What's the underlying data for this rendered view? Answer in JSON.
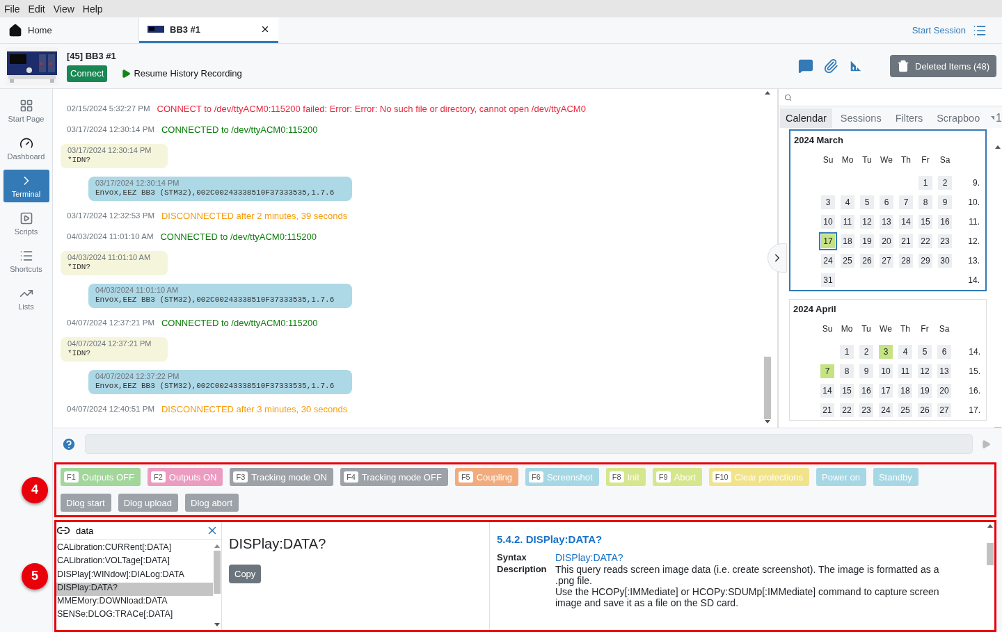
{
  "menu": [
    "File",
    "Edit",
    "View",
    "Help"
  ],
  "tabs": [
    {
      "label": "Home",
      "kind": "home",
      "selected": false,
      "closable": false
    },
    {
      "label": "BB3 #1",
      "kind": "instrument",
      "selected": true,
      "closable": true
    }
  ],
  "session_link": "Start Session",
  "instrument": {
    "title": "[45] BB3 #1",
    "connect": "Connect",
    "history": "Resume History Recording",
    "deleted": "Deleted Items (48)"
  },
  "sidebar": [
    {
      "label": "Start Page",
      "kind": "grid",
      "selected": false
    },
    {
      "label": "Dashboard",
      "kind": "gauge",
      "selected": false
    },
    {
      "label": "Terminal",
      "kind": "terminal",
      "selected": true
    },
    {
      "label": "Scripts",
      "kind": "scripts",
      "selected": false
    },
    {
      "label": "Shortcuts",
      "kind": "shortcuts",
      "selected": false
    },
    {
      "label": "Lists",
      "kind": "lists",
      "selected": false
    }
  ],
  "log": [
    {
      "kind": "error",
      "time": "02/15/2024 5:32:27 PM",
      "text": "CONNECT to /dev/ttyACM0:115200 failed: Error: Error: No such file or directory, cannot open /dev/ttyACM0"
    },
    {
      "kind": "connected",
      "time": "03/17/2024 12:30:14 PM",
      "text": "CONNECTED to /dev/ttyACM0:115200"
    },
    {
      "kind": "request",
      "time": "03/17/2024 12:30:14 PM",
      "text": "*IDN?"
    },
    {
      "kind": "response",
      "time": "03/17/2024 12:30:14 PM",
      "text": "Envox,EEZ BB3 (STM32),002C00243338510F37333535,1.7.6"
    },
    {
      "kind": "disconnected",
      "time": "03/17/2024 12:32:53 PM",
      "text": "DISCONNECTED after 2 minutes, 39 seconds"
    },
    {
      "kind": "connected",
      "time": "04/03/2024 11:01:10 AM",
      "text": "CONNECTED to /dev/ttyACM0:115200"
    },
    {
      "kind": "request",
      "time": "04/03/2024 11:01:10 AM",
      "text": "*IDN?"
    },
    {
      "kind": "response",
      "time": "04/03/2024 11:01:10 AM",
      "text": "Envox,EEZ BB3 (STM32),002C00243338510F37333535,1.7.6"
    },
    {
      "kind": "connected",
      "time": "04/07/2024 12:37:21 PM",
      "text": "CONNECTED to /dev/ttyACM0:115200"
    },
    {
      "kind": "request",
      "time": "04/07/2024 12:37:21 PM",
      "text": "*IDN?"
    },
    {
      "kind": "response",
      "time": "04/07/2024 12:37:22 PM",
      "text": "Envox,EEZ BB3 (STM32),002C00243338510F37333535,1.7.6"
    },
    {
      "kind": "disconnected",
      "time": "04/07/2024 12:40:51 PM",
      "text": "DISCONNECTED after 3 minutes, 30 seconds"
    }
  ],
  "history_tabs": [
    {
      "label": "Calendar",
      "selected": true
    },
    {
      "label": "Sessions",
      "selected": false
    },
    {
      "label": "Filters",
      "selected": false
    },
    {
      "label": "Scrapboo",
      "selected": false
    }
  ],
  "history_tabs_more": "1",
  "calendar": [
    {
      "title": "2024 March",
      "focused": true,
      "weekdays": [
        "Su",
        "Mo",
        "Tu",
        "We",
        "Th",
        "Fr",
        "Sa"
      ],
      "weeks": [
        {
          "number": "9.",
          "kind": "end",
          "days": [
            {
              "day": "1",
              "has_data": false,
              "selected": false
            },
            {
              "day": "2",
              "has_data": false,
              "selected": false
            }
          ]
        },
        {
          "number": "10.",
          "days": [
            {
              "day": "3",
              "has_data": false,
              "selected": false
            },
            {
              "day": "4",
              "has_data": false,
              "selected": false
            },
            {
              "day": "5",
              "has_data": false,
              "selected": false
            },
            {
              "day": "6",
              "has_data": false,
              "selected": false
            },
            {
              "day": "7",
              "has_data": false,
              "selected": false
            },
            {
              "day": "8",
              "has_data": false,
              "selected": false
            },
            {
              "day": "9",
              "has_data": false,
              "selected": false
            }
          ]
        },
        {
          "number": "11.",
          "days": [
            {
              "day": "10",
              "has_data": false,
              "selected": false
            },
            {
              "day": "11",
              "has_data": false,
              "selected": false
            },
            {
              "day": "12",
              "has_data": false,
              "selected": false
            },
            {
              "day": "13",
              "has_data": false,
              "selected": false
            },
            {
              "day": "14",
              "has_data": false,
              "selected": false
            },
            {
              "day": "15",
              "has_data": false,
              "selected": false
            },
            {
              "day": "16",
              "has_data": false,
              "selected": false
            }
          ]
        },
        {
          "number": "12.",
          "days": [
            {
              "day": "17",
              "has_data": true,
              "selected": true
            },
            {
              "day": "18",
              "has_data": false,
              "selected": false
            },
            {
              "day": "19",
              "has_data": false,
              "selected": false
            },
            {
              "day": "20",
              "has_data": false,
              "selected": false
            },
            {
              "day": "21",
              "has_data": false,
              "selected": false
            },
            {
              "day": "22",
              "has_data": false,
              "selected": false
            },
            {
              "day": "23",
              "has_data": false,
              "selected": false
            }
          ]
        },
        {
          "number": "13.",
          "days": [
            {
              "day": "24",
              "has_data": false,
              "selected": false
            },
            {
              "day": "25",
              "has_data": false,
              "selected": false
            },
            {
              "day": "26",
              "has_data": false,
              "selected": false
            },
            {
              "day": "27",
              "has_data": false,
              "selected": false
            },
            {
              "day": "28",
              "has_data": false,
              "selected": false
            },
            {
              "day": "29",
              "has_data": false,
              "selected": false
            },
            {
              "day": "30",
              "has_data": false,
              "selected": false
            }
          ]
        },
        {
          "number": "14.",
          "days": [
            {
              "day": "31",
              "has_data": false,
              "selected": false
            }
          ]
        }
      ]
    },
    {
      "title": "2024 April",
      "focused": false,
      "weekdays": [
        "Su",
        "Mo",
        "Tu",
        "We",
        "Th",
        "Fr",
        "Sa"
      ],
      "weeks": [
        {
          "number": "14.",
          "kind": "end",
          "days": [
            {
              "day": "1",
              "has_data": false,
              "selected": false
            },
            {
              "day": "2",
              "has_data": false,
              "selected": false
            },
            {
              "day": "3",
              "has_data": true,
              "selected": false
            },
            {
              "day": "4",
              "has_data": false,
              "selected": false
            },
            {
              "day": "5",
              "has_data": false,
              "selected": false
            },
            {
              "day": "6",
              "has_data": false,
              "selected": false
            }
          ]
        },
        {
          "number": "15.",
          "days": [
            {
              "day": "7",
              "has_data": true,
              "selected": false
            },
            {
              "day": "8",
              "has_data": false,
              "selected": false
            },
            {
              "day": "9",
              "has_data": false,
              "selected": false
            },
            {
              "day": "10",
              "has_data": false,
              "selected": false
            },
            {
              "day": "11",
              "has_data": false,
              "selected": false
            },
            {
              "day": "12",
              "has_data": false,
              "selected": false
            },
            {
              "day": "13",
              "has_data": false,
              "selected": false
            }
          ]
        },
        {
          "number": "16.",
          "days": [
            {
              "day": "14",
              "has_data": false,
              "selected": false
            },
            {
              "day": "15",
              "has_data": false,
              "selected": false
            },
            {
              "day": "16",
              "has_data": false,
              "selected": false
            },
            {
              "day": "17",
              "has_data": false,
              "selected": false
            },
            {
              "day": "18",
              "has_data": false,
              "selected": false
            },
            {
              "day": "19",
              "has_data": false,
              "selected": false
            },
            {
              "day": "20",
              "has_data": false,
              "selected": false
            }
          ]
        },
        {
          "number": "17.",
          "days": [
            {
              "day": "21",
              "has_data": false,
              "selected": false
            },
            {
              "day": "22",
              "has_data": false,
              "selected": false
            },
            {
              "day": "23",
              "has_data": false,
              "selected": false
            },
            {
              "day": "24",
              "has_data": false,
              "selected": false
            },
            {
              "day": "25",
              "has_data": false,
              "selected": false
            },
            {
              "day": "26",
              "has_data": false,
              "selected": false
            },
            {
              "day": "27",
              "has_data": false,
              "selected": false
            }
          ]
        }
      ]
    }
  ],
  "shortcuts": {
    "annotation": "4",
    "items": [
      {
        "key": "F1",
        "label": "Outputs OFF",
        "color": "#a2d69b"
      },
      {
        "key": "F2",
        "label": "Outputs ON",
        "color": "#eb9cc0"
      },
      {
        "key": "F3",
        "label": "Tracking mode ON",
        "color": "#9da2a8"
      },
      {
        "key": "F4",
        "label": "Tracking mode OFF",
        "color": "#9da2a8"
      },
      {
        "key": "F5",
        "label": "Coupling",
        "color": "#f1ab7c"
      },
      {
        "key": "F6",
        "label": "Screenshot",
        "color": "#a6d7e4"
      },
      {
        "key": "F8",
        "label": "Init",
        "color": "#d6e68c"
      },
      {
        "key": "F9",
        "label": "Abort",
        "color": "#d6e68c"
      },
      {
        "key": "F10",
        "label": "Clear protections",
        "color": "#f1e38a"
      },
      {
        "label": "Power on",
        "color": "#a6d7e4"
      },
      {
        "label": "Standby",
        "color": "#a6d7e4"
      },
      {
        "label": "Dlog start",
        "color": "#9da2a8"
      },
      {
        "label": "Dlog upload",
        "color": "#9da2a8"
      },
      {
        "label": "Dlog abort",
        "color": "#9da2a8"
      }
    ]
  },
  "help": {
    "annotation": "5",
    "search": "data",
    "commands": [
      {
        "label": "CALibration:CURRent[:DATA]",
        "selected": false
      },
      {
        "label": "CALibration:VOLTage[:DATA]",
        "selected": false
      },
      {
        "label": "DISPlay[:WINdow]:DIALog:DATA",
        "selected": false
      },
      {
        "label": "DISPlay:DATA?",
        "selected": true
      },
      {
        "label": "MMEMory:DOWNload:DATA",
        "selected": false
      },
      {
        "label": "SENSe:DLOG:TRACe[:DATA]",
        "selected": false
      }
    ],
    "command_title": "DISPlay:DATA?",
    "copy": "Copy",
    "doc": {
      "heading": "5.4.2. DISPlay:DATA?",
      "syntax_label": "Syntax",
      "syntax": "DISPlay:DATA?",
      "description_label": "Description",
      "description": [
        "This query reads screen image data (i.e. create screenshot). The image is formatted as a .png file.",
        "Use the HCOPy[:IMMediate] or HCOPy:SDUMp[:IMMediate] command to capture screen image and save it as a file on the SD card."
      ]
    }
  }
}
